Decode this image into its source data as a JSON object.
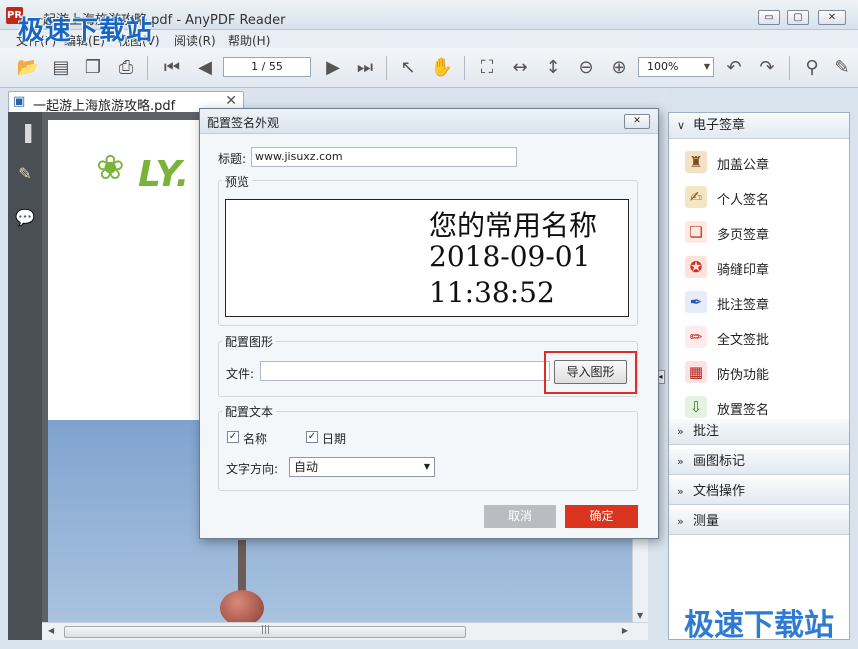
{
  "window": {
    "title": "一起游上海旅游攻略.pdf - AnyPDF Reader",
    "app_icon": "PR",
    "minimize": "▭",
    "maximize": "▢",
    "close": "✕"
  },
  "watermark": {
    "top": "极速下载站",
    "bottom": "极速下载站"
  },
  "menu": [
    "文件(F)",
    "编辑(E)",
    "视图(V)",
    "阅读(R)",
    "帮助(H)"
  ],
  "toolbar": {
    "page_indicator": "1 / 55",
    "zoom_value": "100%",
    "icons": [
      "open-folder-icon",
      "save-icon",
      "copy-icon",
      "print-icon",
      "first-page-icon",
      "prev-page-icon",
      "next-page-icon",
      "last-page-icon",
      "select-icon",
      "hand-icon",
      "fit-page-icon",
      "fit-width-icon",
      "fit-height-icon",
      "zoom-out-icon",
      "zoom-in-icon",
      "undo-icon",
      "redo-icon",
      "binoculars-icon",
      "tools-icon"
    ]
  },
  "tab": {
    "label": "一起游上海旅游攻略.pdf",
    "close": "✕"
  },
  "document": {
    "logo_text": "LY."
  },
  "right_panel": {
    "sections": [
      {
        "label": "电子签章",
        "expanded": true
      },
      {
        "label": "批注",
        "expanded": false
      },
      {
        "label": "画图标记",
        "expanded": false
      },
      {
        "label": "文档操作",
        "expanded": false
      },
      {
        "label": "测量",
        "expanded": false
      }
    ],
    "items": [
      {
        "label": "加盖公章",
        "icon": "stamp-icon"
      },
      {
        "label": "个人签名",
        "icon": "signature-icon"
      },
      {
        "label": "多页签章",
        "icon": "multi-page-stamp-icon"
      },
      {
        "label": "骑缝印章",
        "icon": "seam-stamp-icon"
      },
      {
        "label": "批注签章",
        "icon": "annotation-sign-icon"
      },
      {
        "label": "全文签批",
        "icon": "pen-icon"
      },
      {
        "label": "防伪功能",
        "icon": "qr-code-icon"
      },
      {
        "label": "放置签名",
        "icon": "place-signature-icon"
      }
    ]
  },
  "dialog": {
    "title": "配置签名外观",
    "close": "✕",
    "title_field_label": "标题:",
    "title_field_value": "www.jisuxz.com",
    "preview_group": "预览",
    "preview_lines": [
      "您的常用名称",
      "2018-09-01",
      "11:38:52"
    ],
    "graphic_group": "配置图形",
    "file_label": "文件:",
    "file_value": "",
    "import_button": "导入图形",
    "text_group": "配置文本",
    "name_checkbox": "名称",
    "date_checkbox": "日期",
    "direction_label": "文字方向:",
    "direction_value": "自动",
    "cancel_button": "取消",
    "ok_button": "确定"
  }
}
